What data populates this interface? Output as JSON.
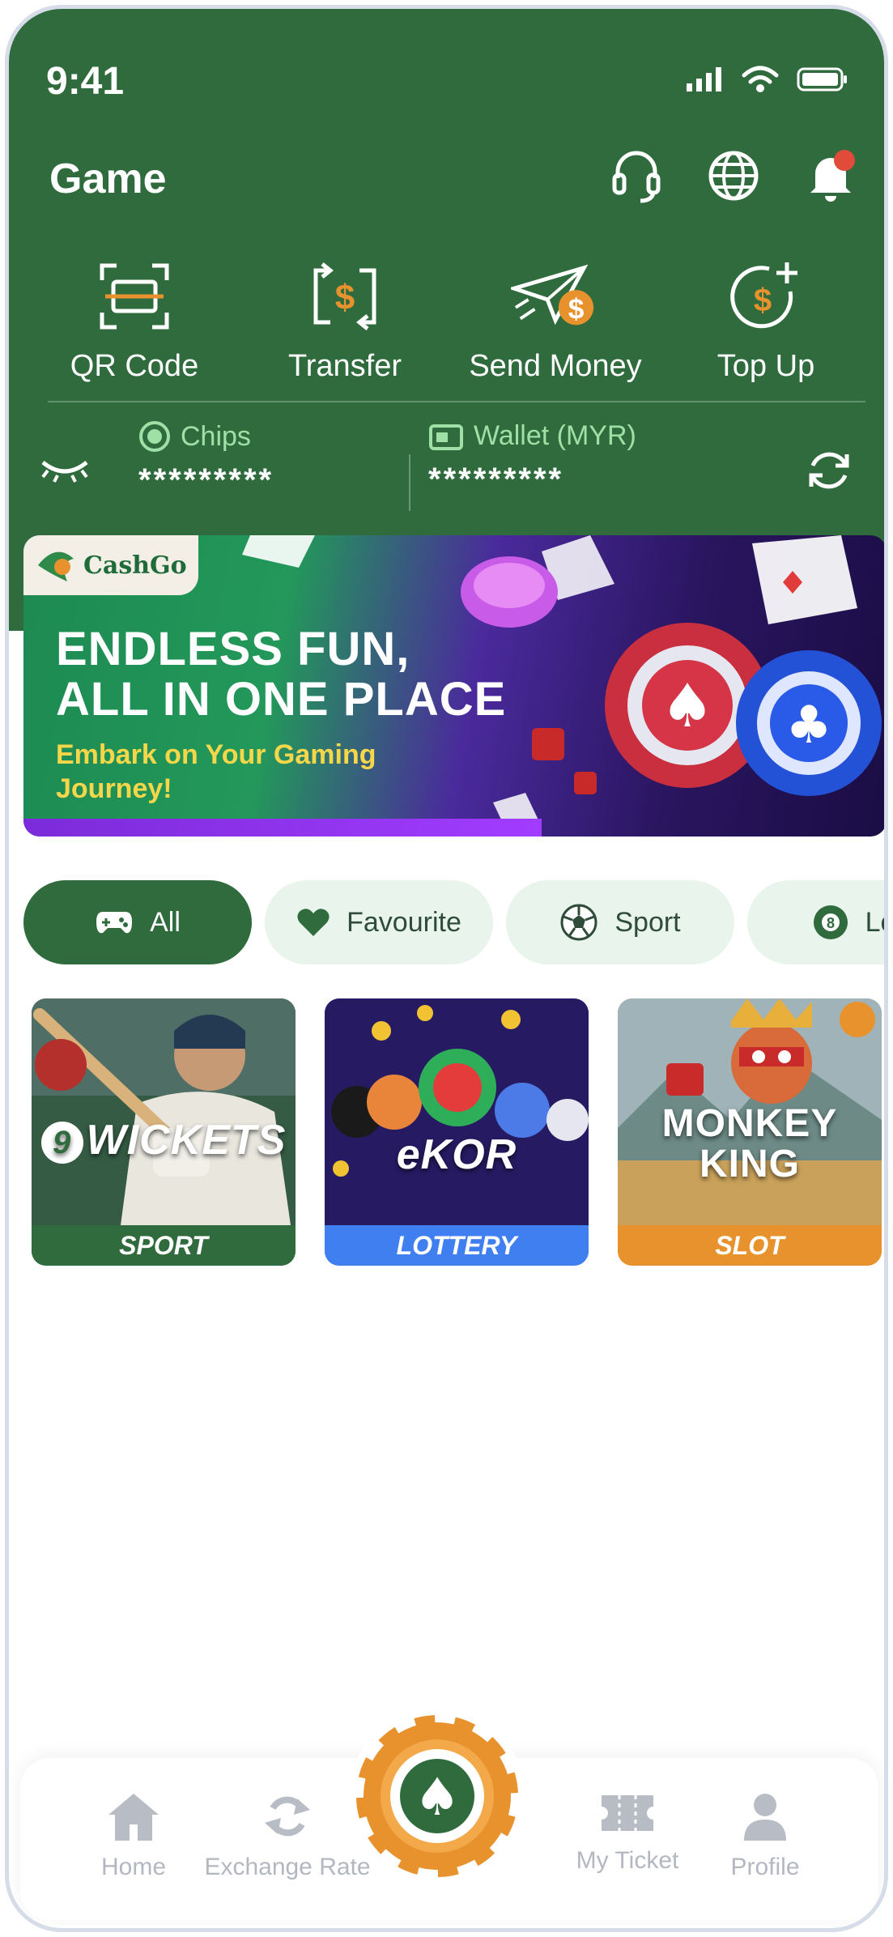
{
  "status_bar": {
    "time": "9:41"
  },
  "header": {
    "title": "Game"
  },
  "actions": [
    {
      "label": "QR Code"
    },
    {
      "label": "Transfer"
    },
    {
      "label": "Send Money"
    },
    {
      "label": "Top Up"
    }
  ],
  "balance": {
    "chips_label": "Chips",
    "chips_value": "*********",
    "wallet_label": "Wallet (MYR)",
    "wallet_value": "*********"
  },
  "banner": {
    "brand": "CashGo",
    "headline_1": "ENDLESS FUN,",
    "headline_2": "ALL IN ONE PLACE",
    "sub_1": "Embark on Your Gaming",
    "sub_2": "Journey!"
  },
  "tabs": [
    {
      "label": "All",
      "icon": "gamepad-icon"
    },
    {
      "label": "Favourite",
      "icon": "heart-icon"
    },
    {
      "label": "Sport",
      "icon": "soccer-ball-icon"
    },
    {
      "label": "Lott",
      "icon": "lottery-ball-icon"
    }
  ],
  "games": [
    {
      "title": "WICKETS",
      "prefix": "9",
      "category": "SPORT",
      "color": "#2f6b3d"
    },
    {
      "title": "eKOR",
      "prefix": "",
      "category": "LOTTERY",
      "color": "#3f7ff0"
    },
    {
      "title": "MONKEY KING",
      "prefix": "",
      "category": "SLOT",
      "color": "#e8922e"
    }
  ],
  "nav": [
    {
      "label": "Home",
      "icon": "home-icon"
    },
    {
      "label": "Exchange Rate",
      "icon": "exchange-icon"
    },
    {
      "label": "My Ticket",
      "icon": "ticket-icon"
    },
    {
      "label": "Profile",
      "icon": "profile-icon"
    }
  ],
  "colors": {
    "primary": "#2f6b3d",
    "accent": "#e8922e",
    "tab_bg": "#e9f4ec"
  }
}
